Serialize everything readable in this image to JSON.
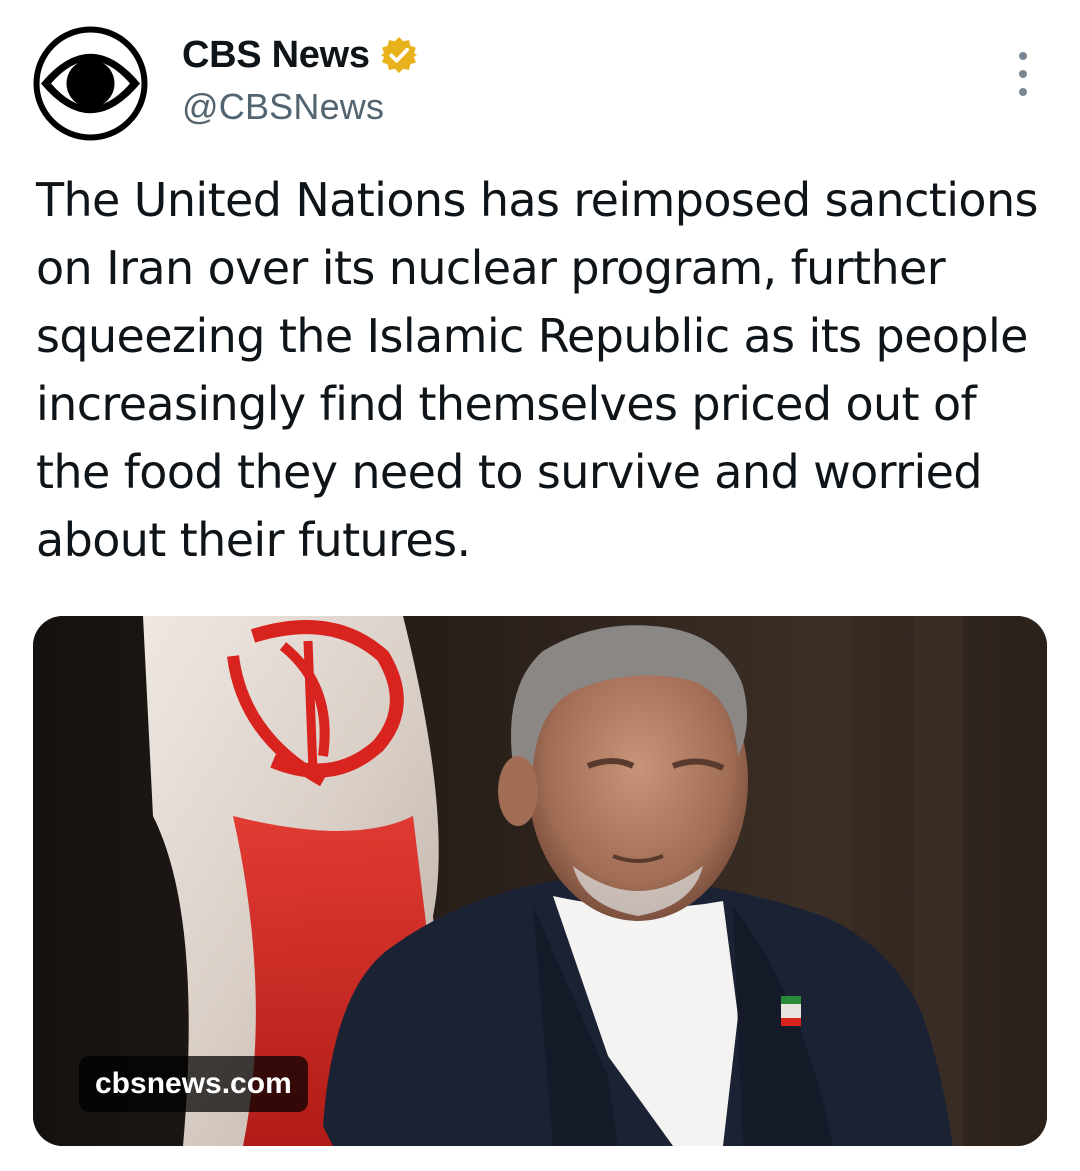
{
  "account": {
    "display_name": "CBS News",
    "handle": "@CBSNews",
    "verified_badge": "verified-gold-check-icon",
    "avatar_icon": "cbs-eye-logo-icon"
  },
  "tweet": {
    "text": "The United Nations has reimposed sanctions on Iran over its nuclear program, further squeezing the Islamic Republic as its people increasingly find themselves priced out of the food they need to survive and worried about their futures."
  },
  "media": {
    "link_label": "cbsnews.com",
    "image_subject": "man-in-suit-with-iranian-flag"
  },
  "menu": {
    "icon": "more-vertical-icon"
  },
  "colors": {
    "text_primary": "#0f1419",
    "text_secondary": "#536471",
    "verified_gold": "#e8b21d",
    "flag_red": "#d8231f"
  }
}
